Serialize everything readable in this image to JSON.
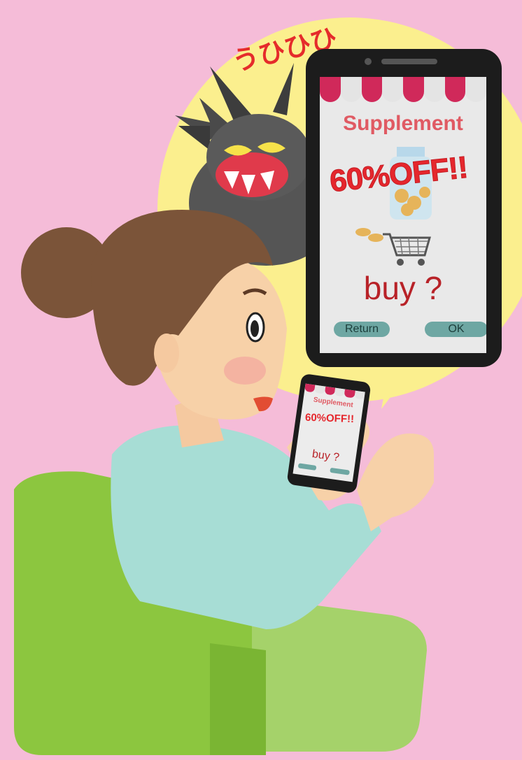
{
  "sound_effect": "うひひひ",
  "big_phone": {
    "title": "Supplement",
    "offer": "60%OFF!!",
    "question": "buy ?",
    "return_label": "Return",
    "ok_label": "OK"
  },
  "small_phone": {
    "title": "Supplement",
    "offer": "60%OFF!!",
    "question": "buy ?",
    "return_label": "",
    "ok_label": ""
  },
  "colors": {
    "background": "#f5bcd8",
    "bubble": "#fbef8e",
    "chair": "#8cc63f",
    "awning_red": "#d0295a",
    "awning_white": "#e4e4e4",
    "button": "#6ea7a3"
  }
}
